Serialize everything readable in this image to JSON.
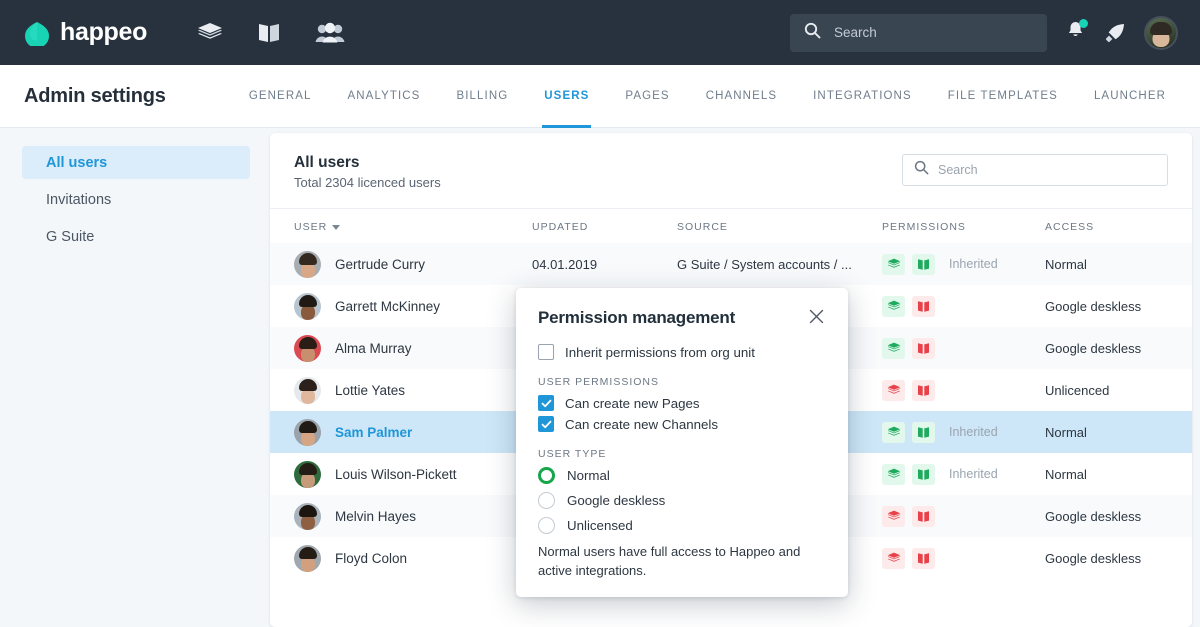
{
  "topbar": {
    "brand": "happeo",
    "icons": [
      {
        "name": "pages-layers-icon"
      },
      {
        "name": "channels-book-icon"
      },
      {
        "name": "people-icon"
      }
    ],
    "search": {
      "placeholder": "Search",
      "value": ""
    },
    "notifications_icon": "bell-icon",
    "launcher_icon": "rocket-icon",
    "avatar": "user-avatar",
    "bg_color": "#28323e",
    "dot_color": "#19d3b5"
  },
  "subheader": {
    "title": "Admin settings",
    "tabs": [
      {
        "label": "GENERAL",
        "active": false
      },
      {
        "label": "ANALYTICS",
        "active": false
      },
      {
        "label": "BILLING",
        "active": false
      },
      {
        "label": "USERS",
        "active": true
      },
      {
        "label": "PAGES",
        "active": false
      },
      {
        "label": "CHANNELS",
        "active": false
      },
      {
        "label": "INTEGRATIONS",
        "active": false
      },
      {
        "label": "FILE TEMPLATES",
        "active": false
      },
      {
        "label": "LAUNCHER",
        "active": false
      }
    ],
    "accent_color": "#1f96d8"
  },
  "sidebar": {
    "items": [
      {
        "label": "All users",
        "active": true
      },
      {
        "label": "Invitations",
        "active": false
      },
      {
        "label": "G Suite",
        "active": false
      }
    ]
  },
  "card": {
    "title": "All users",
    "subtitle": "Total 2304 licenced users",
    "search": {
      "placeholder": "Search",
      "value": ""
    },
    "columns": [
      "USER",
      "UPDATED",
      "SOURCE",
      "PERMISSIONS",
      "ACCESS"
    ],
    "sort_column": "USER",
    "rows": [
      {
        "name": "Gertrude Curry",
        "updated": "04.01.2019",
        "source": "G Suite / System accounts / ...",
        "pages": "allowed",
        "channels": "allowed",
        "inherited": "Inherited",
        "access": "Normal",
        "selected": false,
        "avatar_skin": "#d8a886",
        "avatar_hair": "#33291f",
        "avatar_bg": "#a8adb2"
      },
      {
        "name": "Garrett McKinney",
        "updated": "",
        "source": "",
        "pages": "allowed",
        "channels": "denied",
        "inherited": "",
        "access": "Google deskless",
        "selected": false,
        "avatar_skin": "#8a5a3c",
        "avatar_hair": "#211a14",
        "avatar_bg": "#b9c5ce"
      },
      {
        "name": "Alma Murray",
        "updated": "",
        "source": "",
        "pages": "allowed",
        "channels": "denied",
        "inherited": "",
        "access": "Google deskless",
        "selected": false,
        "avatar_skin": "#c88f6e",
        "avatar_hair": "#2a1d16",
        "avatar_bg": "#d94a52"
      },
      {
        "name": "Lottie Yates",
        "updated": "",
        "source": "",
        "pages": "denied",
        "channels": "denied",
        "inherited": "",
        "access": "Unlicenced",
        "selected": false,
        "avatar_skin": "#e0b79c",
        "avatar_hair": "#2b211a",
        "avatar_bg": "#e6e9ec"
      },
      {
        "name": "Sam Palmer",
        "updated": "",
        "source": "",
        "pages": "allowed",
        "channels": "allowed",
        "inherited": "Inherited",
        "access": "Normal",
        "selected": true,
        "avatar_skin": "#d6a684",
        "avatar_hair": "#1f1a14",
        "avatar_bg": "#9aa2ab"
      },
      {
        "name": "Louis Wilson-Pickett",
        "updated": "",
        "source": "",
        "pages": "allowed",
        "channels": "allowed",
        "inherited": "Inherited",
        "access": "Normal",
        "selected": false,
        "avatar_skin": "#c79a7a",
        "avatar_hair": "#241d15",
        "avatar_bg": "#2f6b3d"
      },
      {
        "name": "Melvin Hayes",
        "updated": "",
        "source": "",
        "pages": "denied",
        "channels": "denied",
        "inherited": "",
        "access": "Google deskless",
        "selected": false,
        "avatar_skin": "#8e5f40",
        "avatar_hair": "#1d1610",
        "avatar_bg": "#aab3bb"
      },
      {
        "name": "Floyd Colon",
        "updated": "",
        "source": "",
        "pages": "denied",
        "channels": "denied",
        "inherited": "",
        "access": "Google deskless",
        "selected": false,
        "avatar_skin": "#d2a07e",
        "avatar_hair": "#241c15",
        "avatar_bg": "#9fa7af"
      }
    ]
  },
  "modal": {
    "title": "Permission management",
    "close_icon": "close-icon",
    "inherit": {
      "label": "Inherit permissions from org unit",
      "checked": false
    },
    "permissions_section_label": "USER PERMISSIONS",
    "permissions": [
      {
        "label": "Can create new Pages",
        "checked": true
      },
      {
        "label": "Can create new Channels",
        "checked": true
      }
    ],
    "user_type_section_label": "USER TYPE",
    "user_types": [
      {
        "label": "Normal",
        "selected": true
      },
      {
        "label": "Google deskless",
        "selected": false
      },
      {
        "label": "Unlicensed",
        "selected": false
      }
    ],
    "note": "Normal users have full access to Happeo and active integrations.",
    "selected_color": "#16a64a",
    "checkbox_color": "#1f96d8"
  }
}
